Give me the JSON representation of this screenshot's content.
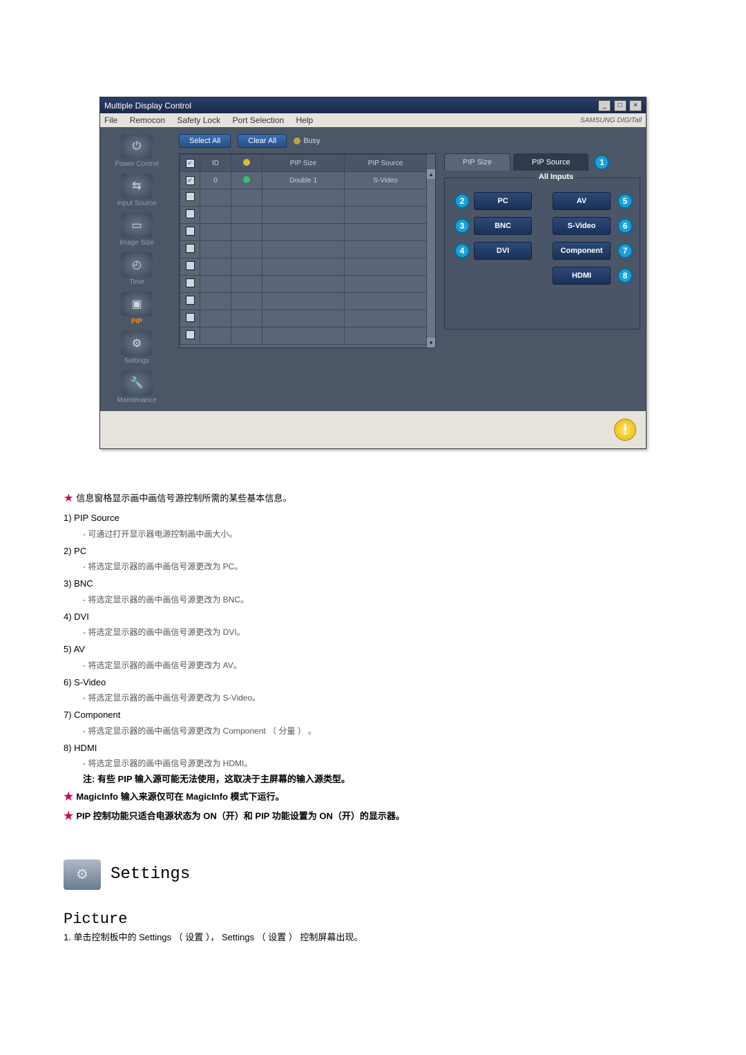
{
  "window": {
    "title": "Multiple Display Control",
    "min": "_",
    "max": "□",
    "close": "×"
  },
  "menubar": {
    "file": "File",
    "remocon": "Remocon",
    "safety": "Safety Lock",
    "port": "Port Selection",
    "help": "Help",
    "brand": "SAMSUNG DIGITall"
  },
  "sidebar": {
    "power": "Power Control",
    "input": "Input Source",
    "image": "Image Size",
    "time": "Time",
    "pip": "PIP",
    "settings": "Settings",
    "maintenance": "Maintenance"
  },
  "toolbar": {
    "select_all": "Select All",
    "clear_all": "Clear All",
    "busy": "Busy"
  },
  "grid": {
    "cols": {
      "id": "ID",
      "pip_size": "PIP Size",
      "pip_source": "PIP Source"
    },
    "row0": {
      "id": "0",
      "pip_size": "Double 1",
      "pip_source": "S-Video"
    }
  },
  "right": {
    "tab_size": "PIP Size",
    "tab_source": "PIP Source",
    "heading": "All Inputs",
    "pc": "PC",
    "bnc": "BNC",
    "dvi": "DVI",
    "av": "AV",
    "svideo": "S-Video",
    "component": "Component",
    "hdmi": "HDMI"
  },
  "markers": {
    "m1": "1",
    "m2": "2",
    "m3": "3",
    "m4": "4",
    "m5": "5",
    "m6": "6",
    "m7": "7",
    "m8": "8"
  },
  "footer": {
    "warn": "!"
  },
  "doc": {
    "intro": "信息窗格显示画中画信号源控制所需的某些基本信息。",
    "i1": {
      "head": "1) PIP Source",
      "sub": "- 可通过打开显示器电源控制画中画大小。"
    },
    "i2": {
      "head": "2) PC",
      "sub": "- 将选定显示器的画中画信号源更改为 PC。"
    },
    "i3": {
      "head": "3) BNC",
      "sub": "- 将选定显示器的画中画信号源更改为 BNC。"
    },
    "i4": {
      "head": "4) DVI",
      "sub": "- 将选定显示器的画中画信号源更改为 DVI。"
    },
    "i5": {
      "head": "5) AV",
      "sub": "- 将选定显示器的画中画信号源更改为 AV。"
    },
    "i6": {
      "head": "6) S-Video",
      "sub": "- 将选定显示器的画中画信号源更改为 S-Video。"
    },
    "i7": {
      "head": "7) Component",
      "sub": "- 将选定显示器的画中画信号源更改为 Component （ 分量 ） 。"
    },
    "i8": {
      "head": "8) HDMI",
      "sub": "- 将选定显示器的画中画信号源更改为 HDMI。"
    },
    "note": "注: 有些 PIP 输入源可能无法使用，这取决于主屏幕的输入源类型。",
    "star1": "MagicInfo 输入来源仅可在 MagicInfo 模式下运行。",
    "star2": "PIP 控制功能只适合电源状态为 ON（开）和 PIP 功能设置为 ON（开）的显示器。"
  },
  "settings_section": {
    "title": "Settings",
    "picture_title": "Picture",
    "picture_line": "1. 单击控制板中的 Settings （ 设置 ）， Settings （ 设置 ） 控制屏幕出现。"
  }
}
